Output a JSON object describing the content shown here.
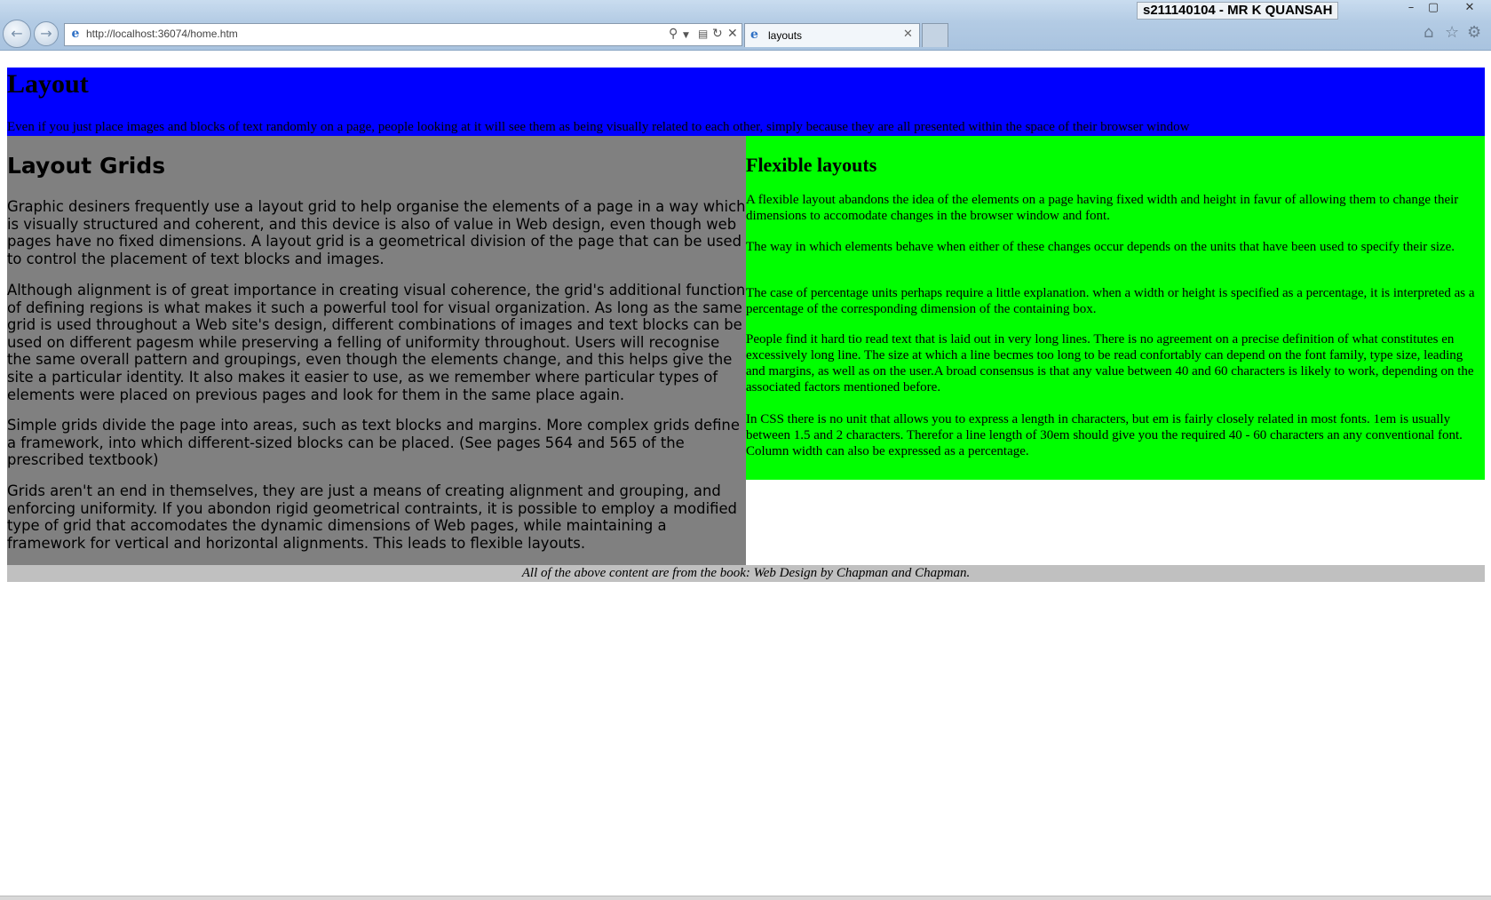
{
  "browser": {
    "user_label": "s211140104 - MR K QUANSAH",
    "url": "http://localhost:36074/home.htm",
    "tab_label": "layouts",
    "window_controls": {
      "minimize": "–",
      "maximize": "▢",
      "close": "✕"
    },
    "icons": [
      "back-icon",
      "forward-icon",
      "ie-icon",
      "search-icon",
      "compat-icon",
      "refresh-icon",
      "stop-icon",
      "home-icon",
      "star-icon",
      "gear-icon"
    ]
  },
  "page": {
    "header": {
      "title": "Layout",
      "intro": "Even if you just place images and blocks of text randomly on a page, people looking at it will see them as being visually related to each other, simply because they are all presented within the space of their browser window"
    },
    "left": {
      "heading": "Layout Grids",
      "paragraphs": [
        "Graphic desiners frequently use a layout grid to help organise the elements of a page in a way which is visually structured and coherent, and this device is also of value in Web design, even though web pages have no fixed dimensions. A layout grid is a geometrical division of the page that can be used to control the placement of text blocks and images.",
        "Although alignment is of great importance in creating visual coherence, the grid's additional function of defining regions is what makes it such a powerful tool for visual organization. As long as the same grid is used throughout a Web site's design, different combinations of images and text blocks can be used on different pagesm while preserving a felling of uniformity throughout. Users will recognise the same overall pattern and groupings, even though the elements change, and this helps give the site a particular identity. It also makes it easier to use, as we remember where particular types of elements were placed on previous pages and look for them in the same place again.",
        "Simple grids divide the page into areas, such as text blocks and margins. More complex grids define a framework, into which different-sized blocks can be placed. (See pages 564 and 565 of the prescribed textbook)",
        "Grids aren't an end in themselves, they are just a means of creating alignment and grouping, and enforcing uniformity. If you abondon rigid geometrical contraints, it is possible to employ a modified type of grid that accomodates the dynamic dimensions of Web pages, while maintaining a framework for vertical and horizontal alignments. This leads to flexible layouts."
      ]
    },
    "right": {
      "heading": "Flexible layouts",
      "paragraphs": [
        "A flexible layout abandons the idea of the elements on a page having fixed width and height in favur of allowing them to change their dimensions to accomodate changes in the browser window and font.",
        "The way in which elements behave when either of these changes occur depends on the units that have been used to specify their size.",
        "The case of percentage units perhaps require a little explanation. when a width or height is specified as a percentage, it is interpreted as a percentage of the corresponding dimension of the containing box.",
        "People find it hard tio read text that is laid out in very long lines. There is no agreement on a precise definition of what constitutes en excessively long line. The size at which a line becmes too long to be read confortably can depend on the font family, type size, leading and margins, as well as on the user.A broad consensus is that any value between 40 and 60 characters is likely to work, depending on the associated factors mentioned before.",
        "In CSS there is no unit that allows you to express a length in characters, but em is fairly closely related in most fonts. 1em is usually between 1.5 and 2 characters. Therefor a line length of 30em should give you the required 40 - 60 characters an any conventional font. Column width can also be expressed as a percentage."
      ]
    },
    "footer": "All of the above content are from the book: Web Design by Chapman and Chapman."
  },
  "colors": {
    "header_bg": "#0000ff",
    "left_bg": "#808080",
    "right_bg": "#00ff00",
    "footer_bg": "#c0c0c0"
  }
}
